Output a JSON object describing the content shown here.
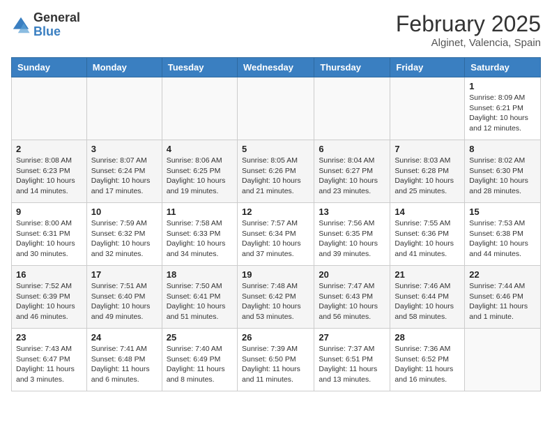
{
  "header": {
    "logo": {
      "general": "General",
      "blue": "Blue"
    },
    "title": "February 2025",
    "location": "Alginet, Valencia, Spain"
  },
  "calendar": {
    "weekdays": [
      "Sunday",
      "Monday",
      "Tuesday",
      "Wednesday",
      "Thursday",
      "Friday",
      "Saturday"
    ],
    "weeks": [
      [
        {
          "day": "",
          "info": ""
        },
        {
          "day": "",
          "info": ""
        },
        {
          "day": "",
          "info": ""
        },
        {
          "day": "",
          "info": ""
        },
        {
          "day": "",
          "info": ""
        },
        {
          "day": "",
          "info": ""
        },
        {
          "day": "1",
          "info": "Sunrise: 8:09 AM\nSunset: 6:21 PM\nDaylight: 10 hours and 12 minutes."
        }
      ],
      [
        {
          "day": "2",
          "info": "Sunrise: 8:08 AM\nSunset: 6:23 PM\nDaylight: 10 hours and 14 minutes."
        },
        {
          "day": "3",
          "info": "Sunrise: 8:07 AM\nSunset: 6:24 PM\nDaylight: 10 hours and 17 minutes."
        },
        {
          "day": "4",
          "info": "Sunrise: 8:06 AM\nSunset: 6:25 PM\nDaylight: 10 hours and 19 minutes."
        },
        {
          "day": "5",
          "info": "Sunrise: 8:05 AM\nSunset: 6:26 PM\nDaylight: 10 hours and 21 minutes."
        },
        {
          "day": "6",
          "info": "Sunrise: 8:04 AM\nSunset: 6:27 PM\nDaylight: 10 hours and 23 minutes."
        },
        {
          "day": "7",
          "info": "Sunrise: 8:03 AM\nSunset: 6:28 PM\nDaylight: 10 hours and 25 minutes."
        },
        {
          "day": "8",
          "info": "Sunrise: 8:02 AM\nSunset: 6:30 PM\nDaylight: 10 hours and 28 minutes."
        }
      ],
      [
        {
          "day": "9",
          "info": "Sunrise: 8:00 AM\nSunset: 6:31 PM\nDaylight: 10 hours and 30 minutes."
        },
        {
          "day": "10",
          "info": "Sunrise: 7:59 AM\nSunset: 6:32 PM\nDaylight: 10 hours and 32 minutes."
        },
        {
          "day": "11",
          "info": "Sunrise: 7:58 AM\nSunset: 6:33 PM\nDaylight: 10 hours and 34 minutes."
        },
        {
          "day": "12",
          "info": "Sunrise: 7:57 AM\nSunset: 6:34 PM\nDaylight: 10 hours and 37 minutes."
        },
        {
          "day": "13",
          "info": "Sunrise: 7:56 AM\nSunset: 6:35 PM\nDaylight: 10 hours and 39 minutes."
        },
        {
          "day": "14",
          "info": "Sunrise: 7:55 AM\nSunset: 6:36 PM\nDaylight: 10 hours and 41 minutes."
        },
        {
          "day": "15",
          "info": "Sunrise: 7:53 AM\nSunset: 6:38 PM\nDaylight: 10 hours and 44 minutes."
        }
      ],
      [
        {
          "day": "16",
          "info": "Sunrise: 7:52 AM\nSunset: 6:39 PM\nDaylight: 10 hours and 46 minutes."
        },
        {
          "day": "17",
          "info": "Sunrise: 7:51 AM\nSunset: 6:40 PM\nDaylight: 10 hours and 49 minutes."
        },
        {
          "day": "18",
          "info": "Sunrise: 7:50 AM\nSunset: 6:41 PM\nDaylight: 10 hours and 51 minutes."
        },
        {
          "day": "19",
          "info": "Sunrise: 7:48 AM\nSunset: 6:42 PM\nDaylight: 10 hours and 53 minutes."
        },
        {
          "day": "20",
          "info": "Sunrise: 7:47 AM\nSunset: 6:43 PM\nDaylight: 10 hours and 56 minutes."
        },
        {
          "day": "21",
          "info": "Sunrise: 7:46 AM\nSunset: 6:44 PM\nDaylight: 10 hours and 58 minutes."
        },
        {
          "day": "22",
          "info": "Sunrise: 7:44 AM\nSunset: 6:46 PM\nDaylight: 11 hours and 1 minute."
        }
      ],
      [
        {
          "day": "23",
          "info": "Sunrise: 7:43 AM\nSunset: 6:47 PM\nDaylight: 11 hours and 3 minutes."
        },
        {
          "day": "24",
          "info": "Sunrise: 7:41 AM\nSunset: 6:48 PM\nDaylight: 11 hours and 6 minutes."
        },
        {
          "day": "25",
          "info": "Sunrise: 7:40 AM\nSunset: 6:49 PM\nDaylight: 11 hours and 8 minutes."
        },
        {
          "day": "26",
          "info": "Sunrise: 7:39 AM\nSunset: 6:50 PM\nDaylight: 11 hours and 11 minutes."
        },
        {
          "day": "27",
          "info": "Sunrise: 7:37 AM\nSunset: 6:51 PM\nDaylight: 11 hours and 13 minutes."
        },
        {
          "day": "28",
          "info": "Sunrise: 7:36 AM\nSunset: 6:52 PM\nDaylight: 11 hours and 16 minutes."
        },
        {
          "day": "",
          "info": ""
        }
      ]
    ]
  }
}
